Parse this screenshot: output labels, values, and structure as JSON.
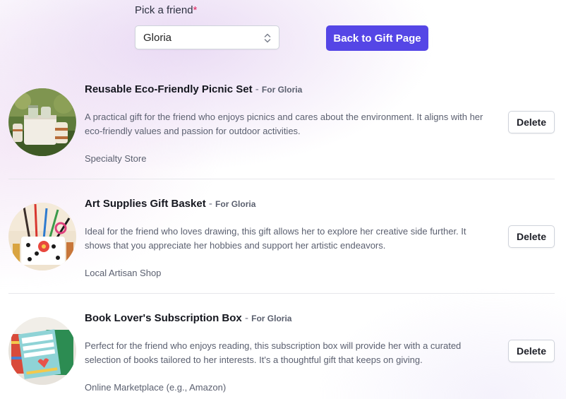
{
  "picker": {
    "label": "Pick a friend",
    "required_mark": "*",
    "selected": "Gloria"
  },
  "back_button": {
    "label": "Back to Gift Page"
  },
  "colors": {
    "primary": "#5546e6",
    "required": "#e0245e"
  },
  "gifts": [
    {
      "title": "Reusable Eco-Friendly Picnic Set",
      "separator": "-",
      "for_label": "For Gloria",
      "description": "A practical gift for the friend who enjoys picnics and cares about the environment. It aligns with her eco-friendly values and passion for outdoor activities.",
      "source": "Specialty Store",
      "delete_label": "Delete",
      "image_icon": "picnic-set-photo"
    },
    {
      "title": "Art Supplies Gift Basket",
      "separator": "-",
      "for_label": "For Gloria",
      "description": "Ideal for the friend who loves drawing, this gift allows her to explore her creative side further. It shows that you appreciate her hobbies and support her artistic endeavors.",
      "source": "Local Artisan Shop",
      "delete_label": "Delete",
      "image_icon": "art-supplies-photo"
    },
    {
      "title": "Book Lover's Subscription Box",
      "separator": "-",
      "for_label": "For Gloria",
      "description": "Perfect for the friend who enjoys reading, this subscription box will provide her with a curated selection of books tailored to her interests. It's a thoughtful gift that keeps on giving.",
      "source": "Online Marketplace (e.g., Amazon)",
      "delete_label": "Delete",
      "image_icon": "book-box-photo"
    }
  ]
}
